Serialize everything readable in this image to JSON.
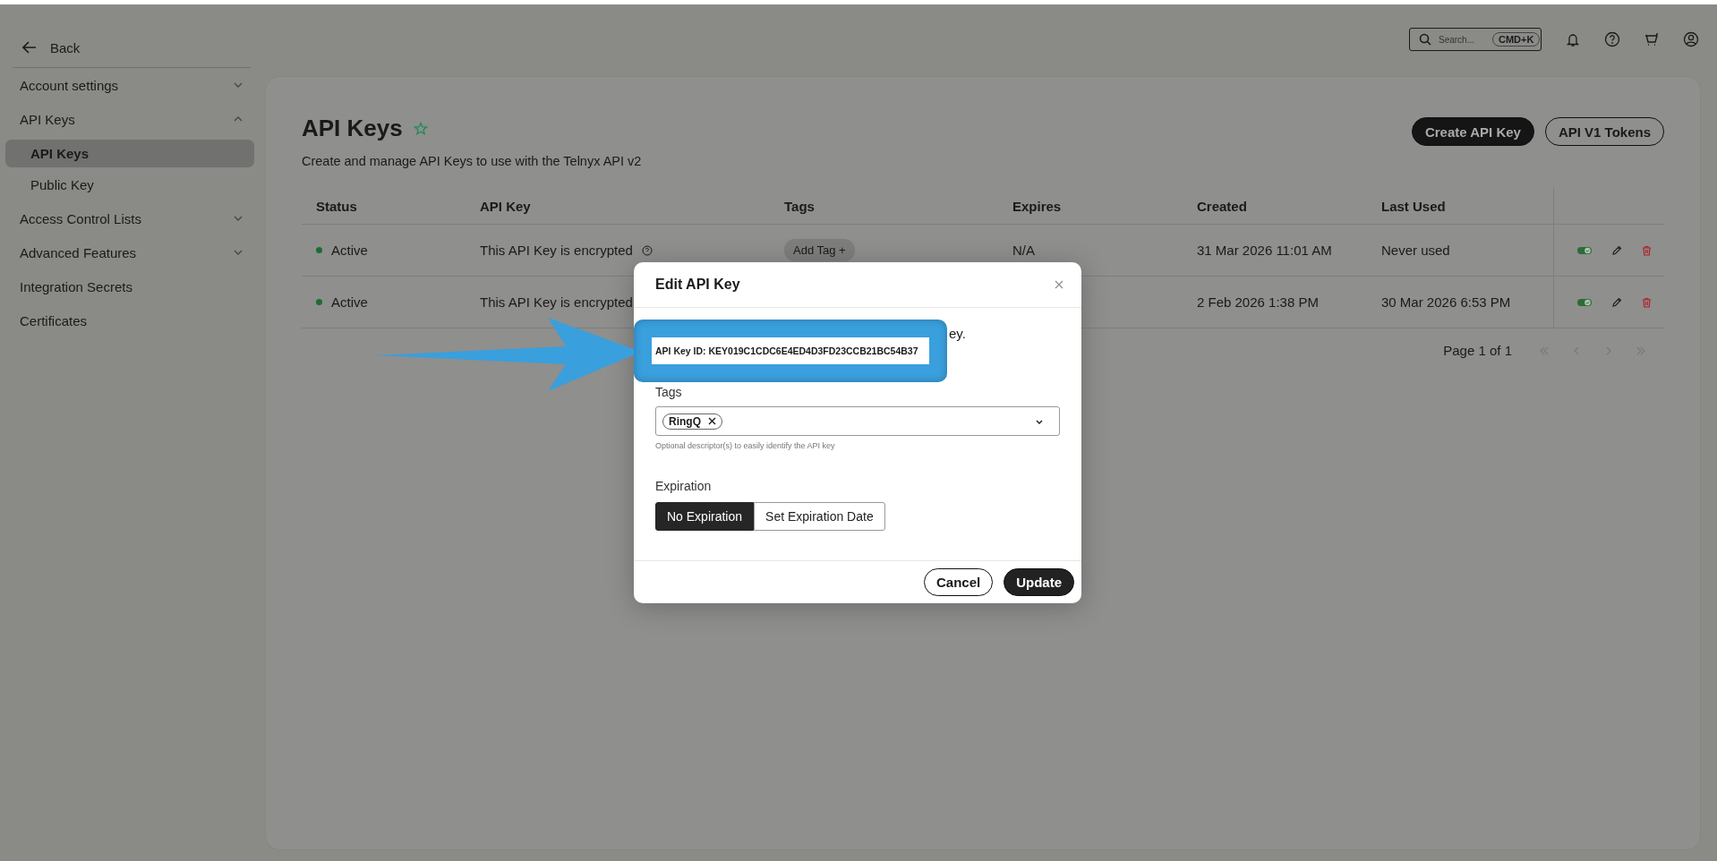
{
  "header": {
    "search": {
      "placeholder": "Search...",
      "shortcut": "CMD+K"
    }
  },
  "sidebar": {
    "back": "Back",
    "items": [
      {
        "label": "Account settings",
        "kind": "group",
        "expanded": false
      },
      {
        "label": "API Keys",
        "kind": "group",
        "expanded": true,
        "children": [
          {
            "label": "API Keys",
            "selected": true
          },
          {
            "label": "Public Key",
            "selected": false
          }
        ]
      },
      {
        "label": "Access Control Lists",
        "kind": "group",
        "expanded": false
      },
      {
        "label": "Advanced Features",
        "kind": "group",
        "expanded": false
      },
      {
        "label": "Integration Secrets",
        "kind": "link"
      },
      {
        "label": "Certificates",
        "kind": "link"
      }
    ]
  },
  "page": {
    "title": "API Keys",
    "favorite": false,
    "subtitle": "Create and manage API Keys to use with the Telnyx API v2",
    "actions": [
      {
        "label": "Create API Key",
        "kind": "primary"
      },
      {
        "label": "API V1 Tokens",
        "kind": "secondary"
      }
    ]
  },
  "table": {
    "columns": [
      "Status",
      "API Key",
      "Tags",
      "Expires",
      "Created",
      "Last Used"
    ],
    "rows": [
      {
        "status": "Active",
        "color": "#1e6b34",
        "api_key": "This API Key is encrypted",
        "help_icon": true,
        "tag_button": "Add Tag +",
        "expires": "N/A",
        "created": "31 Mar 2026 11:01 AM",
        "last_used": "Never used",
        "enabled": true
      },
      {
        "status": "Active",
        "color": "#1e6b34",
        "api_key": "This API Key is encrypted",
        "created": "2 Feb 2026 1:38 PM",
        "last_used": "30 Mar 2026 6:53 PM",
        "enabled": true
      }
    ]
  },
  "pagination": {
    "label": "Page 1 of 1"
  },
  "modal": {
    "title": "Edit API Key",
    "description_tail": "ey.",
    "tags_label": "Tags",
    "tags": [
      "RingQ"
    ],
    "tags_hint": "Optional descriptor(s) to easily identify the API key",
    "expiration_label": "Expiration",
    "expiration_options": [
      {
        "label": "No Expiration",
        "selected": true
      },
      {
        "label": "Set Expiration Date",
        "selected": false
      }
    ],
    "buttons": [
      {
        "label": "Cancel",
        "kind": "secondary"
      },
      {
        "label": "Update",
        "kind": "primary"
      }
    ]
  },
  "annotation": {
    "text": "API Key ID: KEY019C1CDC6E4ED4D3FD23CCB21BC54B37"
  }
}
